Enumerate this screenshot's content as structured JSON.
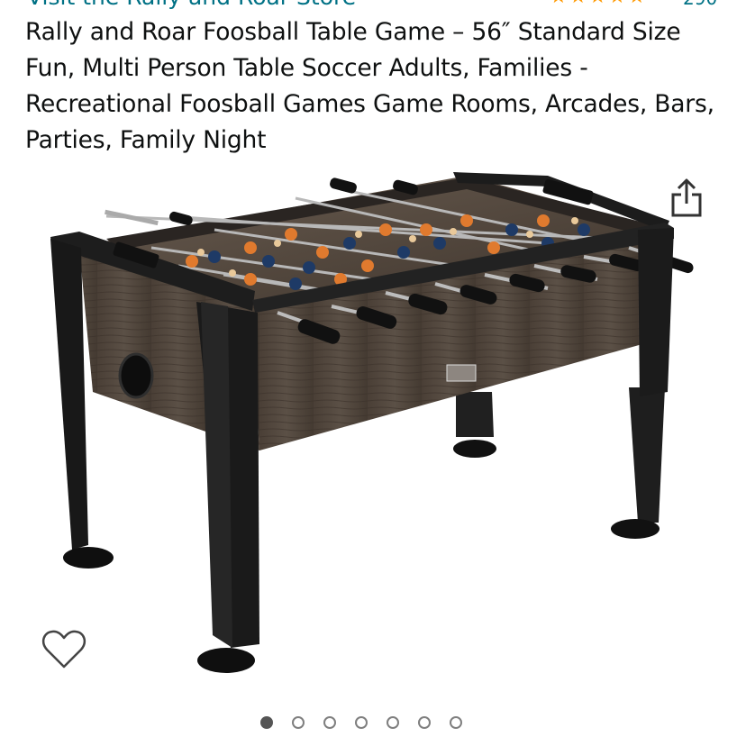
{
  "store": {
    "link_text": "Visit the Rally and Roar Store"
  },
  "rating": {
    "stars": "★★★★★",
    "count": "290"
  },
  "product": {
    "title": "Rally and Roar Foosball Table Game – 56″ Standard Size Fun, Multi Person Table Soccer Adults, Families - Recreational Foosball Games Game Rooms, Arcades, Bars, Parties, Family Night"
  },
  "icons": {
    "share": "share-icon",
    "wishlist": "heart-icon"
  },
  "carousel": {
    "count": 7,
    "active": 1
  },
  "colors": {
    "link": "#007185",
    "star": "#FF9900",
    "text": "#0F1111"
  }
}
